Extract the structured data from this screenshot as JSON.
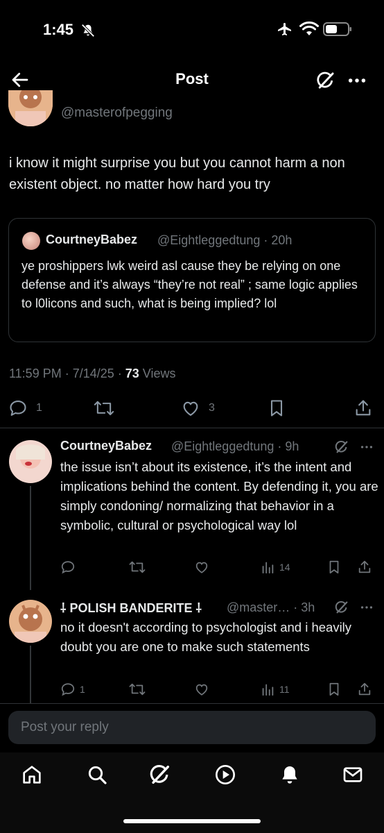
{
  "status_bar": {
    "time": "1:45"
  },
  "header": {
    "title": "Post"
  },
  "main_post": {
    "handle": "@masterofpegging",
    "text": "i know it might surprise you but you cannot harm a non existent object. no matter how hard you try",
    "quote": {
      "name": "CourtneyBabez",
      "handle": "@Eightleggedtung · 20h",
      "text": "ye proshippers lwk weird asl cause they be relying on one defense and it’s always “they’re not real” ; same logic applies to l0licons and such, what is being implied? lol"
    },
    "meta_time": "11:59 PM · 7/14/25 · ",
    "meta_views_count": "73",
    "meta_views_label": " Views",
    "counts": {
      "replies": "1",
      "likes": "3"
    }
  },
  "replies": [
    {
      "name": "CourtneyBabez",
      "handle": "@Eightleggedtung · 9h",
      "text": "the issue isn’t about its existence, it’s the intent and implications behind the content. By defending it, you are simply condoning/ normalizing that behavior in a symbolic, cultural or psychological way lol",
      "views": "14",
      "replies": ""
    },
    {
      "name": "⸸ POLISH BANDERITE ⸸",
      "handle": "@master… · 3h",
      "text": "no it doesn't according to psychologist and i heavily doubt you are one to make such statements",
      "views": "11",
      "replies": "1"
    }
  ],
  "reply_box": {
    "placeholder": "Post your reply"
  },
  "colors": {
    "background": "#000000",
    "text": "#e7e9ea",
    "muted": "#71767b",
    "divider": "#2f3336"
  },
  "icons": [
    "back-arrow-icon",
    "grok-icon",
    "more-icon",
    "reply-icon",
    "repost-icon",
    "like-icon",
    "bookmark-icon",
    "share-icon",
    "views-icon",
    "home-icon",
    "search-icon",
    "play-icon",
    "bell-icon",
    "mail-icon"
  ]
}
